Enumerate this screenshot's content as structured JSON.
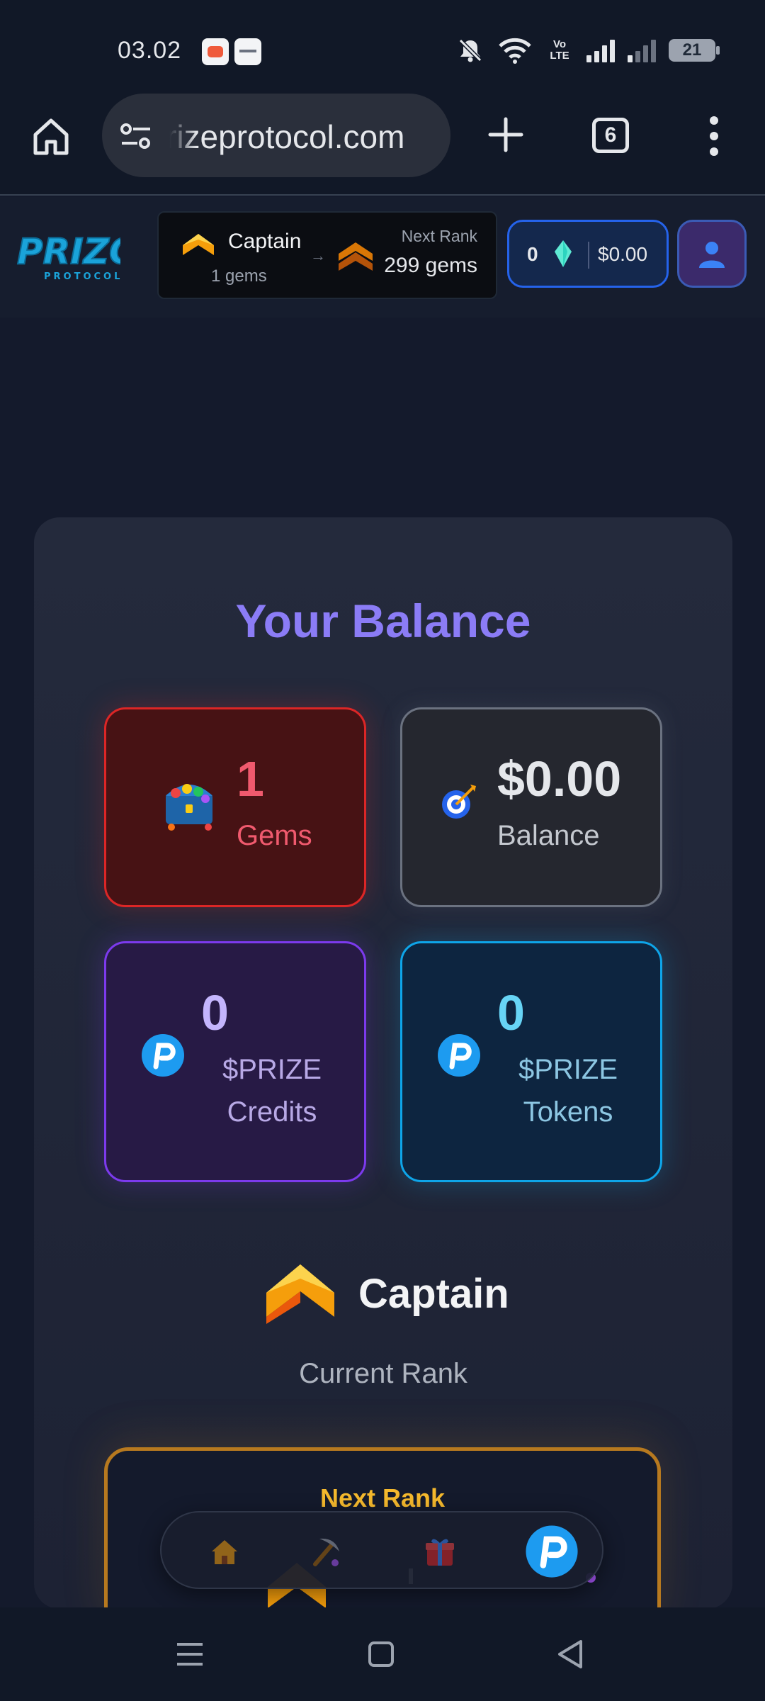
{
  "status_bar": {
    "time": "03.02",
    "network_label": "Vo LTE",
    "battery": "21",
    "icons": [
      "app-notification-icon",
      "app-notification-icon",
      "mute-icon",
      "wifi-icon",
      "signal-icon",
      "signal-icon",
      "battery-icon"
    ]
  },
  "browser": {
    "url": "rizeprotocol.com",
    "tab_count": "6",
    "icons": [
      "home-icon",
      "site-settings-icon",
      "plus-icon",
      "tabs-icon",
      "more-vert-icon"
    ]
  },
  "header": {
    "logo_text": "PRIZO",
    "logo_subtext": "PROTOCOL",
    "rank": {
      "name": "Captain",
      "gems": "1 gems",
      "arrow": "→",
      "next_label": "Next Rank",
      "next_value": "299 gems"
    },
    "wallet": {
      "gems": "0",
      "balance": "$0.00"
    },
    "profile_icon": "user-icon"
  },
  "balance": {
    "title": "Your Balance",
    "tiles": [
      {
        "value": "1",
        "label": "Gems",
        "icon": "treasure-chest-icon",
        "color": "#dc2626"
      },
      {
        "value": "$0.00",
        "label": "Balance",
        "icon": "target-icon",
        "color": "#6b7280"
      },
      {
        "value": "0",
        "label": "$PRIZE Credits",
        "icon": "prize-logo-icon",
        "color": "#7c3aed"
      },
      {
        "value": "0",
        "label": "$PRIZE Tokens",
        "icon": "prize-logo-icon",
        "color": "#0ea5e9"
      }
    ]
  },
  "rank_section": {
    "name": "Captain",
    "subtitle": "Current Rank",
    "next_label": "Next Rank"
  },
  "bottom_nav": {
    "items": [
      "home-icon",
      "pickaxe-icon",
      "gift-icon",
      "prize-logo-icon"
    ],
    "active": "prize-logo-icon"
  },
  "system_nav": [
    "recents-icon",
    "home-icon",
    "back-icon"
  ],
  "colors": {
    "accent": "#8b7cf6",
    "gold": "#f5b92d",
    "background": "#141a2c"
  }
}
